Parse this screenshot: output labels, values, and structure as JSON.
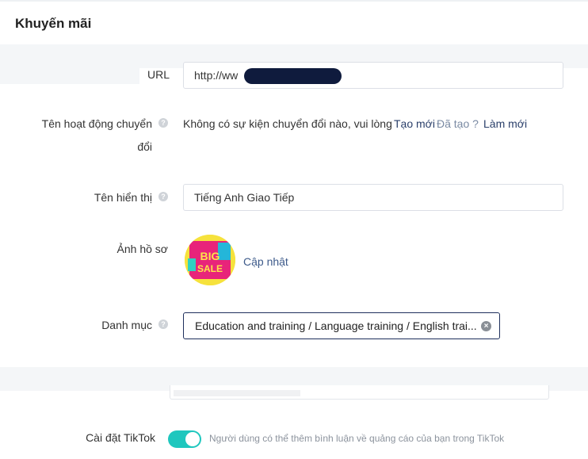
{
  "header": {
    "title": "Khuyến mãi"
  },
  "form": {
    "url": {
      "label": "URL",
      "value": "http://ww"
    },
    "conversion": {
      "label_line1": "Tên hoạt động chuyển",
      "label_line2": "đổi",
      "message": "Không có sự kiện chuyển đổi nào, vui lòng",
      "create_link": "Tạo mới",
      "created_link": "Đã tạo ?",
      "refresh_link": "Làm mới"
    },
    "display_name": {
      "label": "Tên hiển thị",
      "value": "Tiếng Anh Giao Tiếp"
    },
    "profile_image": {
      "label": "Ảnh hồ sơ",
      "update_link": "Cập nhật",
      "image_text": "BIG SALE"
    },
    "category": {
      "label": "Danh mục",
      "value": "Education and training / Language training / English trai..."
    },
    "tiktok": {
      "label": "Cài đặt TikTok",
      "enabled": true,
      "description": "Người dùng có thể thêm bình luận về quảng cáo của bạn trong TikTok"
    }
  },
  "icons": {
    "help": "question-circle-icon",
    "clear": "close-circle-icon"
  },
  "colors": {
    "toggle_on": "#1fc7be",
    "link": "#2a3f6a",
    "focused_border": "#1e2f5c"
  }
}
